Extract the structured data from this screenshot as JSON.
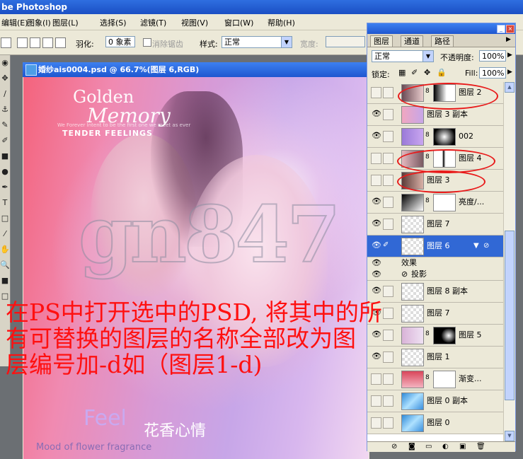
{
  "app": {
    "title": "be Photoshop"
  },
  "menu": [
    "编辑(E)",
    "图象(I)",
    "图层(L)",
    "选择(S)",
    "滤镜(T)",
    "视图(V)",
    "窗口(W)",
    "帮助(H)"
  ],
  "options": {
    "feather_label": "羽化:",
    "feather_value": "0 象素",
    "antialias_label": "消除锯齿",
    "style_label": "样式:",
    "style_value": "正常",
    "width_label": "宽度:"
  },
  "document": {
    "title": "婚纱ais0004.psd @ 66.7%(图层 6,RGB)",
    "logo_line1": "Golden",
    "logo_line2": "Memory",
    "logo_tagline": "We Forever Intent to be the first one we meet as ever",
    "logo_sub": "TENDER FEELINGS",
    "watermark": "gn847",
    "feel": "Feel",
    "feel_cn": "花香心情",
    "mood": "Mood of flower fragrance"
  },
  "annotation": "在PS中打开选中的PSD, 将其中的所\n有可替换的图层的名称全部改为图\n层编号加-d如（图层1-d)",
  "layers_panel": {
    "tabs": [
      "图层",
      "通道",
      "路径"
    ],
    "blend_mode": "正常",
    "opacity_label": "不透明度:",
    "opacity_value": "100%",
    "lock_label": "锁定:",
    "fill_label": "Fill:",
    "fill_value": "100%",
    "layers": [
      {
        "name": "图层 2",
        "visible": false,
        "has_mask": true
      },
      {
        "name": "图层 3 副本",
        "visible": true,
        "has_mask": false
      },
      {
        "name": "002",
        "visible": true,
        "has_mask": true
      },
      {
        "name": "图层 4",
        "visible": false,
        "has_mask": true
      },
      {
        "name": "图层 3",
        "visible": false,
        "has_mask": false
      },
      {
        "name": "亮度/...",
        "visible": true,
        "has_mask": true
      },
      {
        "name": "图层 7",
        "visible": true,
        "has_mask": false
      },
      {
        "name": "图层 6",
        "visible": true,
        "has_mask": false,
        "selected": true
      },
      {
        "name": "效果",
        "visible": true,
        "effect": true
      },
      {
        "name": "投影",
        "visible": true,
        "effect": true
      },
      {
        "name": "图层 8 副本",
        "visible": true,
        "has_mask": false
      },
      {
        "name": "图层 7",
        "visible": true,
        "has_mask": false
      },
      {
        "name": "图层 5",
        "visible": true,
        "has_mask": true
      },
      {
        "name": "图层 1",
        "visible": true,
        "has_mask": false
      },
      {
        "name": "渐变...",
        "visible": false,
        "has_mask": true
      },
      {
        "name": "图层 0 副本",
        "visible": false,
        "has_mask": false
      },
      {
        "name": "图层 0",
        "visible": false,
        "has_mask": false
      }
    ]
  }
}
